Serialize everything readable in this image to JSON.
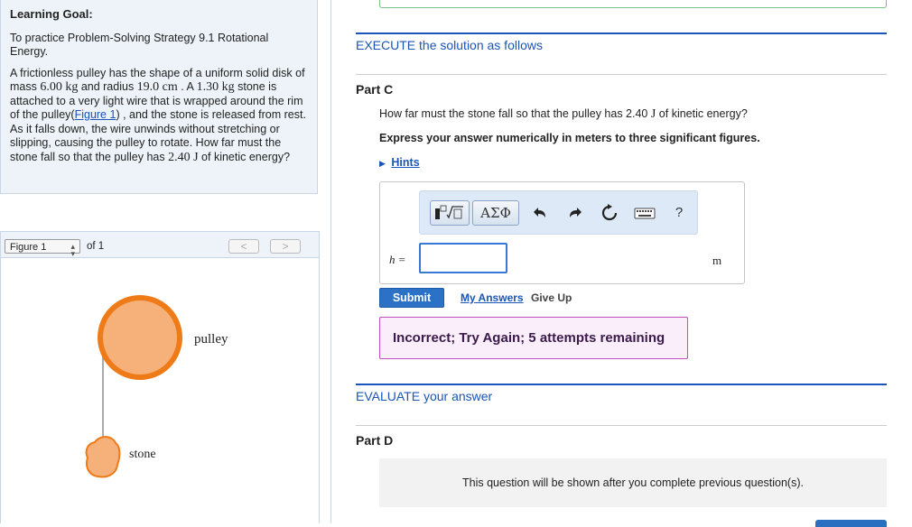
{
  "learning_goal": {
    "title": "Learning Goal:",
    "goal_text": "To practice Problem-Solving Strategy 9.1 Rotational Energy.",
    "problem": {
      "p1": "A frictionless pulley has the shape of a uniform solid disk of mass ",
      "mass": "6.00 kg",
      "p2": " and radius ",
      "radius": "19.0 cm",
      "p3": " . A ",
      "stone_mass": "1.30 kg",
      "p4": " stone is attached to a very light wire that is wrapped around the rim of the pulley(",
      "figure_link": "Figure 1",
      "p5": ") , and the stone is released from rest. As it falls down, the wire unwinds without stretching or slipping, causing the pulley to rotate. How far must the stone fall so that the pulley has ",
      "energy": "2.40 J",
      "p6": " of kinetic energy?"
    }
  },
  "figure": {
    "select_value": "Figure 1",
    "of_text": "of 1",
    "prev_label": "<",
    "next_label": ">",
    "pulley_label": "pulley",
    "stone_label": "stone",
    "colors": {
      "fill": "#f6b07a",
      "stroke": "#ef7a18",
      "wire": "#aaaaaa"
    }
  },
  "execute": {
    "heading": "EXECUTE the solution as follows"
  },
  "part_c": {
    "title": "Part C",
    "question_pre": "How far must the stone fall so that the pulley has 2.40 ",
    "question_unit": "J",
    "question_post": " of kinetic energy?",
    "instruction": "Express your answer numerically in meters to three significant figures.",
    "hints_label": "Hints",
    "toolbar": {
      "templates_icon": "fraction-sqrt-icon",
      "symbols_label": "ΑΣΦ",
      "help_label": "?"
    },
    "variable_label": "h =",
    "input_value": "",
    "unit": "m",
    "submit_label": "Submit",
    "my_answers_label": "My Answers",
    "give_up_label": "Give Up",
    "feedback": "Incorrect; Try Again; 5 attempts remaining"
  },
  "evaluate": {
    "heading": "EVALUATE your answer"
  },
  "part_d": {
    "title": "Part D",
    "locked_message": "This question will be shown after you complete previous question(s)."
  },
  "colors": {
    "accent": "#1a55b8",
    "submit": "#2b72c7",
    "feedback_border": "#c04fc0",
    "feedback_bg": "#fbeefb"
  }
}
